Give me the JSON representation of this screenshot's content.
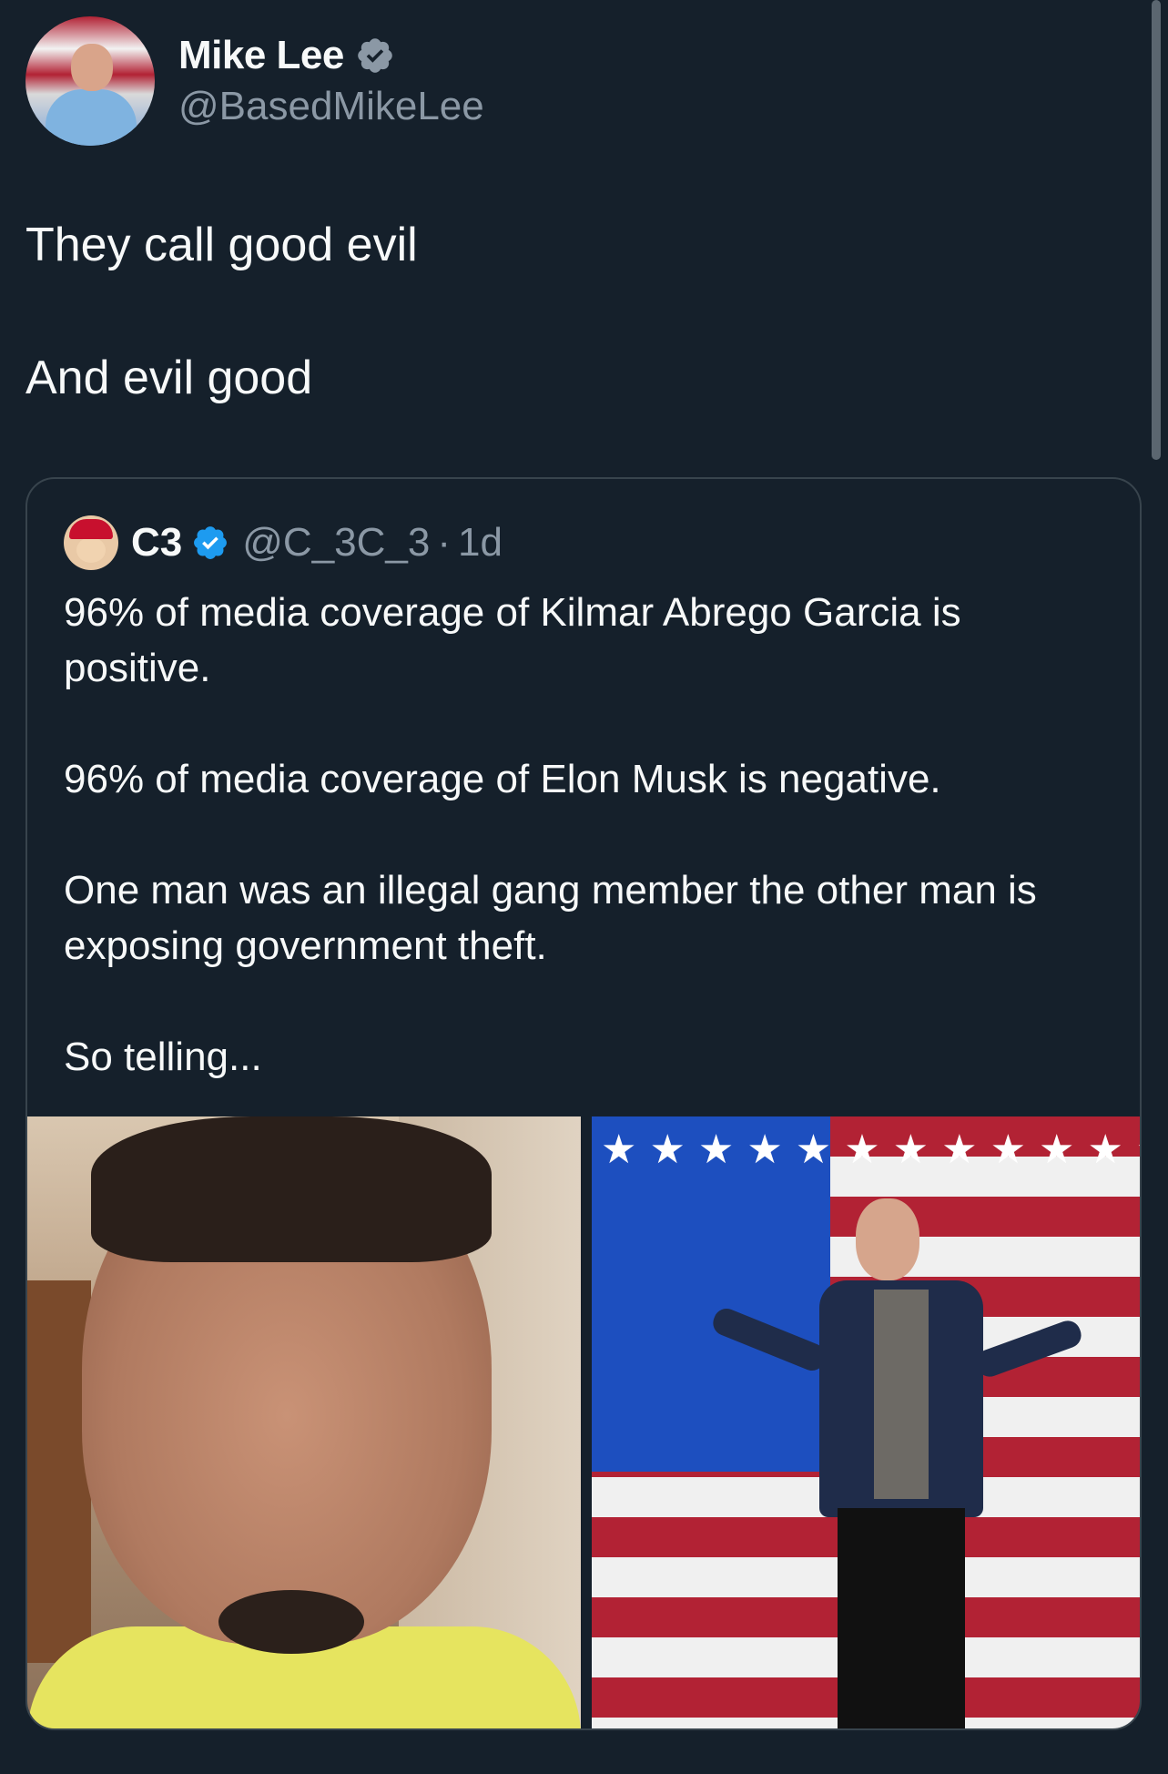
{
  "author": {
    "display_name": "Mike Lee",
    "handle": "@BasedMikeLee",
    "verified_icon": "verified-badge-icon"
  },
  "tweet": {
    "line1": "They call good evil",
    "line2": "And evil good"
  },
  "quoted": {
    "display_name": "C3",
    "handle": "@C_3C_3",
    "separator": "·",
    "time": "1d",
    "paragraphs": [
      "96% of media coverage of Kilmar Abrego Garcia is positive.",
      "96% of media coverage of Elon Musk is negative.",
      "One man was an illegal gang member the other man is exposing government theft.",
      "So telling..."
    ]
  },
  "colors": {
    "background": "#15202b",
    "text": "#f7f9f9",
    "secondary_text": "#8b98a5",
    "border": "#38444d",
    "verified": "#1d9bf0"
  },
  "flag_stars": "★★★★★★★★★★★★★★★★★★★★★★★★"
}
